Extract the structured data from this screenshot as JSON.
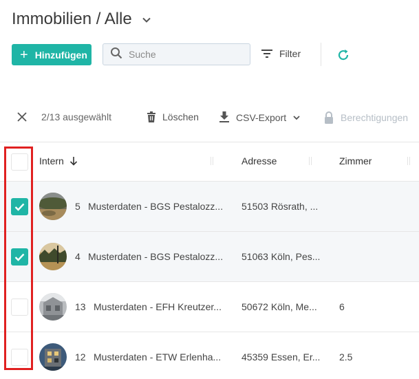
{
  "header": {
    "title": "Immobilien / Alle"
  },
  "toolbar": {
    "add_label": "Hinzufügen",
    "search_placeholder": "Suche",
    "filter_label": "Filter"
  },
  "selection": {
    "count_text": "2/13 ausgewählt",
    "delete_label": "Löschen",
    "csv_label": "CSV-Export",
    "permissions_label": "Berechtigungen"
  },
  "table": {
    "columns": {
      "intern": "Intern",
      "address": "Adresse",
      "rooms": "Zimmer"
    },
    "rows": [
      {
        "id": "5",
        "name": "Musterdaten - BGS Pestalozz...",
        "address": "51503 Rösrath, ...",
        "rooms": "",
        "checked": true
      },
      {
        "id": "4",
        "name": "Musterdaten - BGS Pestalozz...",
        "address": "51063 Köln, Pes...",
        "rooms": "",
        "checked": true
      },
      {
        "id": "13",
        "name": "Musterdaten - EFH Kreutzer...",
        "address": "50672 Köln, Me...",
        "rooms": "6",
        "checked": false
      },
      {
        "id": "12",
        "name": "Musterdaten - ETW Erlenha...",
        "address": "45359 Essen, Er...",
        "rooms": "2.5",
        "checked": false
      }
    ]
  },
  "colors": {
    "accent": "#1fb5a6",
    "highlight": "#e02020",
    "disabled": "#b6bec6"
  }
}
